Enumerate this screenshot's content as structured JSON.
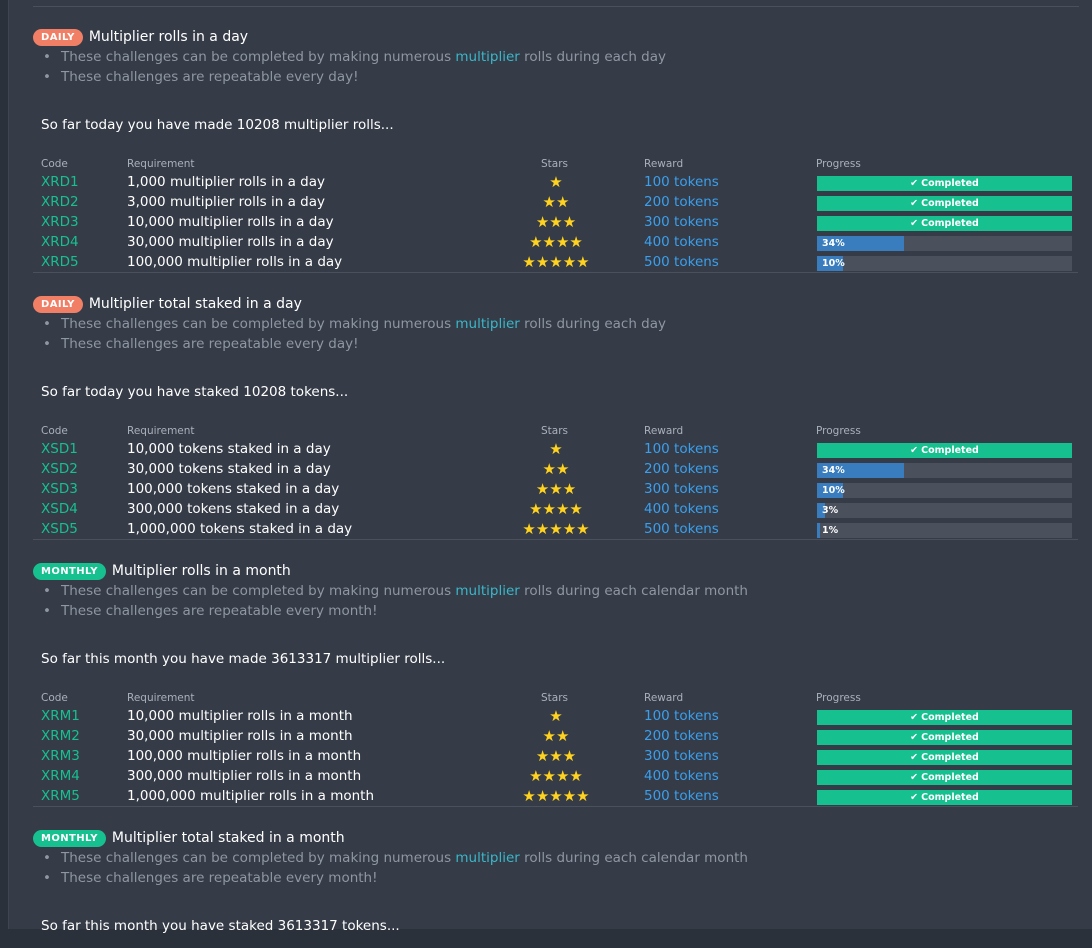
{
  "sections": [
    {
      "badge": "DAILY",
      "badge_type": "daily",
      "title": "Multiplier rolls in a day",
      "bullet1_pre": "These challenges can be completed by making numerous ",
      "bullet1_link": "multiplier",
      "bullet1_post": " rolls during each day",
      "bullet2": "These challenges are repeatable every day!",
      "so_far": "So far today you have made 10208 multiplier rolls...",
      "headers": {
        "code": "Code",
        "requirement": "Requirement",
        "stars": "Stars",
        "reward": "Reward",
        "progress": "Progress"
      },
      "rows": [
        {
          "code": "XRD1",
          "requirement": "1,000 multiplier rolls in a day",
          "stars": 1,
          "stars_text": "★",
          "reward": "100 tokens",
          "progress": 100,
          "progress_label": "Completed"
        },
        {
          "code": "XRD2",
          "requirement": "3,000 multiplier rolls in a day",
          "stars": 2,
          "stars_text": "★★",
          "reward": "200 tokens",
          "progress": 100,
          "progress_label": "Completed"
        },
        {
          "code": "XRD3",
          "requirement": "10,000 multiplier rolls in a day",
          "stars": 3,
          "stars_text": "★★★",
          "reward": "300 tokens",
          "progress": 100,
          "progress_label": "Completed"
        },
        {
          "code": "XRD4",
          "requirement": "30,000 multiplier rolls in a day",
          "stars": 4,
          "stars_text": "★★★★",
          "reward": "400 tokens",
          "progress": 34,
          "progress_label": "34%"
        },
        {
          "code": "XRD5",
          "requirement": "100,000 multiplier rolls in a day",
          "stars": 5,
          "stars_text": "★★★★★",
          "reward": "500 tokens",
          "progress": 10,
          "progress_label": "10%"
        }
      ]
    },
    {
      "badge": "DAILY",
      "badge_type": "daily",
      "title": "Multiplier total staked in a day",
      "bullet1_pre": "These challenges can be completed by making numerous ",
      "bullet1_link": "multiplier",
      "bullet1_post": " rolls during each day",
      "bullet2": "These challenges are repeatable every day!",
      "so_far": "So far today you have staked 10208 tokens...",
      "headers": {
        "code": "Code",
        "requirement": "Requirement",
        "stars": "Stars",
        "reward": "Reward",
        "progress": "Progress"
      },
      "rows": [
        {
          "code": "XSD1",
          "requirement": "10,000 tokens staked in a day",
          "stars": 1,
          "stars_text": "★",
          "reward": "100 tokens",
          "progress": 100,
          "progress_label": "Completed"
        },
        {
          "code": "XSD2",
          "requirement": "30,000 tokens staked in a day",
          "stars": 2,
          "stars_text": "★★",
          "reward": "200 tokens",
          "progress": 34,
          "progress_label": "34%"
        },
        {
          "code": "XSD3",
          "requirement": "100,000 tokens staked in a day",
          "stars": 3,
          "stars_text": "★★★",
          "reward": "300 tokens",
          "progress": 10,
          "progress_label": "10%"
        },
        {
          "code": "XSD4",
          "requirement": "300,000 tokens staked in a day",
          "stars": 4,
          "stars_text": "★★★★",
          "reward": "400 tokens",
          "progress": 3,
          "progress_label": "3%"
        },
        {
          "code": "XSD5",
          "requirement": "1,000,000 tokens staked in a day",
          "stars": 5,
          "stars_text": "★★★★★",
          "reward": "500 tokens",
          "progress": 1,
          "progress_label": "1%"
        }
      ]
    },
    {
      "badge": "MONTHLY",
      "badge_type": "monthly",
      "title": "Multiplier rolls in a month",
      "bullet1_pre": "These challenges can be completed by making numerous ",
      "bullet1_link": "multiplier",
      "bullet1_post": " rolls during each calendar month",
      "bullet2": "These challenges are repeatable every month!",
      "so_far": "So far this month you have made 3613317 multiplier rolls...",
      "headers": {
        "code": "Code",
        "requirement": "Requirement",
        "stars": "Stars",
        "reward": "Reward",
        "progress": "Progress"
      },
      "rows": [
        {
          "code": "XRM1",
          "requirement": "10,000 multiplier rolls in a month",
          "stars": 1,
          "stars_text": "★",
          "reward": "100 tokens",
          "progress": 100,
          "progress_label": "Completed"
        },
        {
          "code": "XRM2",
          "requirement": "30,000 multiplier rolls in a month",
          "stars": 2,
          "stars_text": "★★",
          "reward": "200 tokens",
          "progress": 100,
          "progress_label": "Completed"
        },
        {
          "code": "XRM3",
          "requirement": "100,000 multiplier rolls in a month",
          "stars": 3,
          "stars_text": "★★★",
          "reward": "300 tokens",
          "progress": 100,
          "progress_label": "Completed"
        },
        {
          "code": "XRM4",
          "requirement": "300,000 multiplier rolls in a month",
          "stars": 4,
          "stars_text": "★★★★",
          "reward": "400 tokens",
          "progress": 100,
          "progress_label": "Completed"
        },
        {
          "code": "XRM5",
          "requirement": "1,000,000 multiplier rolls in a month",
          "stars": 5,
          "stars_text": "★★★★★",
          "reward": "500 tokens",
          "progress": 100,
          "progress_label": "Completed"
        }
      ]
    },
    {
      "badge": "MONTHLY",
      "badge_type": "monthly",
      "title": "Multiplier total staked in a month",
      "bullet1_pre": "These challenges can be completed by making numerous ",
      "bullet1_link": "multiplier",
      "bullet1_post": " rolls during each calendar month",
      "bullet2": "These challenges are repeatable every month!",
      "so_far": "So far this month you have staked 3613317 tokens...",
      "headers": {
        "code": "",
        "requirement": "",
        "stars": "",
        "reward": "",
        "progress": ""
      },
      "rows": []
    }
  ],
  "icons": {
    "check": "check-icon",
    "star": "star-icon"
  },
  "colors": {
    "background": "#353b47",
    "daily_badge": "#f07f66",
    "monthly_badge": "#17c08f",
    "code_text": "#17c08f",
    "reward_text": "#3aa0ee",
    "link_text": "#3ab7c9",
    "star": "#ffd21f",
    "progress_done": "#17c08f",
    "progress_partial": "#3a7dbe",
    "progress_track": "#4a505c"
  }
}
